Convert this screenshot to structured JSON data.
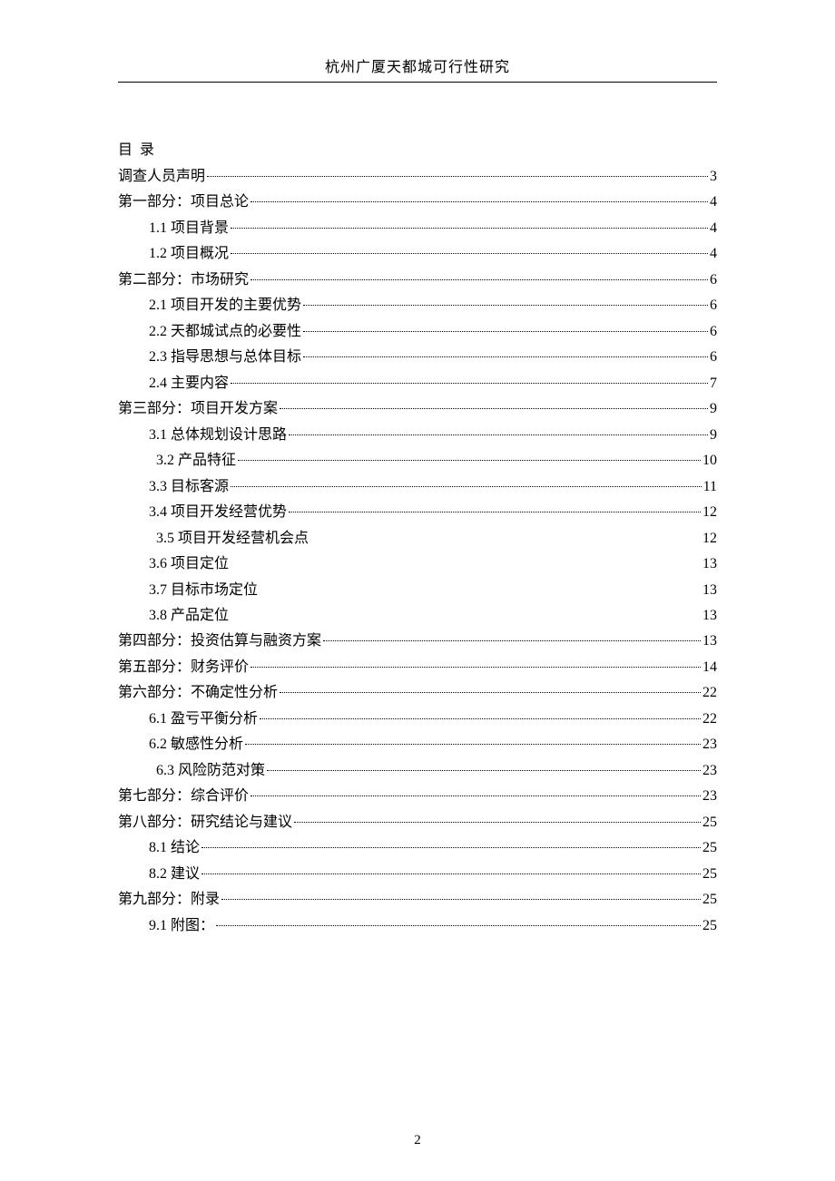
{
  "header": {
    "title": "杭州广厦天都城可行性研究"
  },
  "toc_heading": "目 录",
  "toc": [
    {
      "label": "调查人员声明",
      "page": "3",
      "indent": 0,
      "leader": true
    },
    {
      "label": "第一部分：项目总论",
      "page": "4",
      "indent": 0,
      "leader": true
    },
    {
      "label": "1.1 项目背景",
      "page": "4",
      "indent": 1,
      "leader": true
    },
    {
      "label": "1.2 项目概况",
      "page": "4",
      "indent": 1,
      "leader": true
    },
    {
      "label": "第二部分：市场研究",
      "page": "6",
      "indent": 0,
      "leader": true
    },
    {
      "label": "2.1 项目开发的主要优势",
      "page": "6",
      "indent": 1,
      "leader": true
    },
    {
      "label": "2.2 天都城试点的必要性",
      "page": "6",
      "indent": 1,
      "leader": true
    },
    {
      "label": "2.3 指导思想与总体目标",
      "page": "6",
      "indent": 1,
      "leader": true
    },
    {
      "label": "2.4 主要内容",
      "page": "7",
      "indent": 1,
      "leader": true
    },
    {
      "label": "第三部分：项目开发方案",
      "page": "9",
      "indent": 0,
      "leader": true
    },
    {
      "label": "3.1 总体规划设计思路",
      "page": "9",
      "indent": 1,
      "leader": true
    },
    {
      "label": "3.2 产品特征",
      "page": "10",
      "indent": 2,
      "leader": true
    },
    {
      "label": "3.3 目标客源",
      "page": "11",
      "indent": 1,
      "leader": true
    },
    {
      "label": "3.4 项目开发经营优势",
      "page": "12",
      "indent": 1,
      "leader": true
    },
    {
      "label": "3.5 项目开发经营机会点",
      "page": "12",
      "indent": 2,
      "leader": false
    },
    {
      "label": "3.6 项目定位",
      "page": "13",
      "indent": 1,
      "leader": false
    },
    {
      "label": "3.7 目标市场定位",
      "page": "13",
      "indent": 1,
      "leader": false
    },
    {
      "label": "3.8 产品定位",
      "page": "13",
      "indent": 1,
      "leader": false
    },
    {
      "label": "第四部分：投资估算与融资方案",
      "page": "13",
      "indent": 0,
      "leader": true
    },
    {
      "label": "第五部分：财务评价",
      "page": "14",
      "indent": 0,
      "leader": true
    },
    {
      "label": "第六部分：不确定性分析",
      "page": "22",
      "indent": 0,
      "leader": true
    },
    {
      "label": "6.1 盈亏平衡分析",
      "page": "22",
      "indent": 1,
      "leader": true
    },
    {
      "label": "6.2 敏感性分析",
      "page": "23",
      "indent": 1,
      "leader": true
    },
    {
      "label": "6.3 风险防范对策",
      "page": "23",
      "indent": 2,
      "leader": true
    },
    {
      "label": "第七部分：综合评价",
      "page": "23",
      "indent": 0,
      "leader": true
    },
    {
      "label": "第八部分：研究结论与建议",
      "page": "25",
      "indent": 0,
      "leader": true
    },
    {
      "label": "8.1 结论",
      "page": "25",
      "indent": 1,
      "leader": true
    },
    {
      "label": "8.2 建议",
      "page": "25",
      "indent": 1,
      "leader": true
    },
    {
      "label": "第九部分：附录",
      "page": "25",
      "indent": 0,
      "leader": true
    },
    {
      "label": "9.1 附图：",
      "page": "25",
      "indent": 1,
      "leader": true
    }
  ],
  "footer": {
    "page_number": "2"
  }
}
